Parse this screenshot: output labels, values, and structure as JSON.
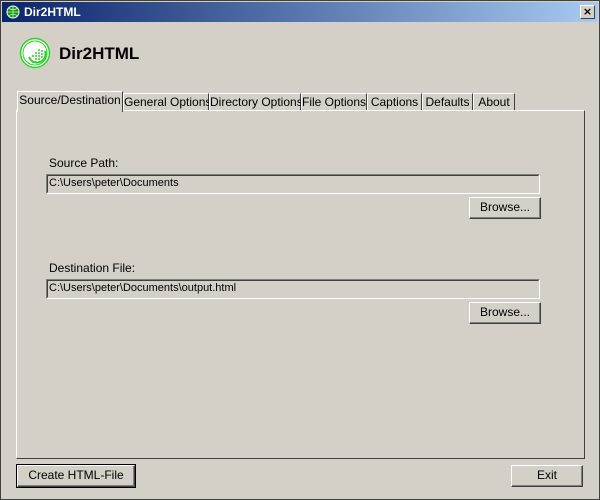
{
  "window": {
    "title": "Dir2HTML",
    "close_label": "×"
  },
  "header": {
    "logo_text": "Dir2HTML"
  },
  "tabs": [
    {
      "label": "Source/Destination",
      "active": true
    },
    {
      "label": "General Options"
    },
    {
      "label": "Directory Options"
    },
    {
      "label": "File Options"
    },
    {
      "label": "Captions"
    },
    {
      "label": "Defaults"
    },
    {
      "label": "About"
    }
  ],
  "source": {
    "label": "Source Path:",
    "value": "C:\\Users\\peter\\Documents",
    "browse_label": "Browse..."
  },
  "destination": {
    "label": "Destination File:",
    "value": "C:\\Users\\peter\\Documents\\output.html",
    "browse_label": "Browse..."
  },
  "footer": {
    "create_label": "Create HTML-File",
    "exit_label": "Exit"
  },
  "colors": {
    "face": "#d4d0c8",
    "title_start": "#0a246a",
    "title_end": "#a6caf0",
    "logo_green": "#2bd62b"
  }
}
